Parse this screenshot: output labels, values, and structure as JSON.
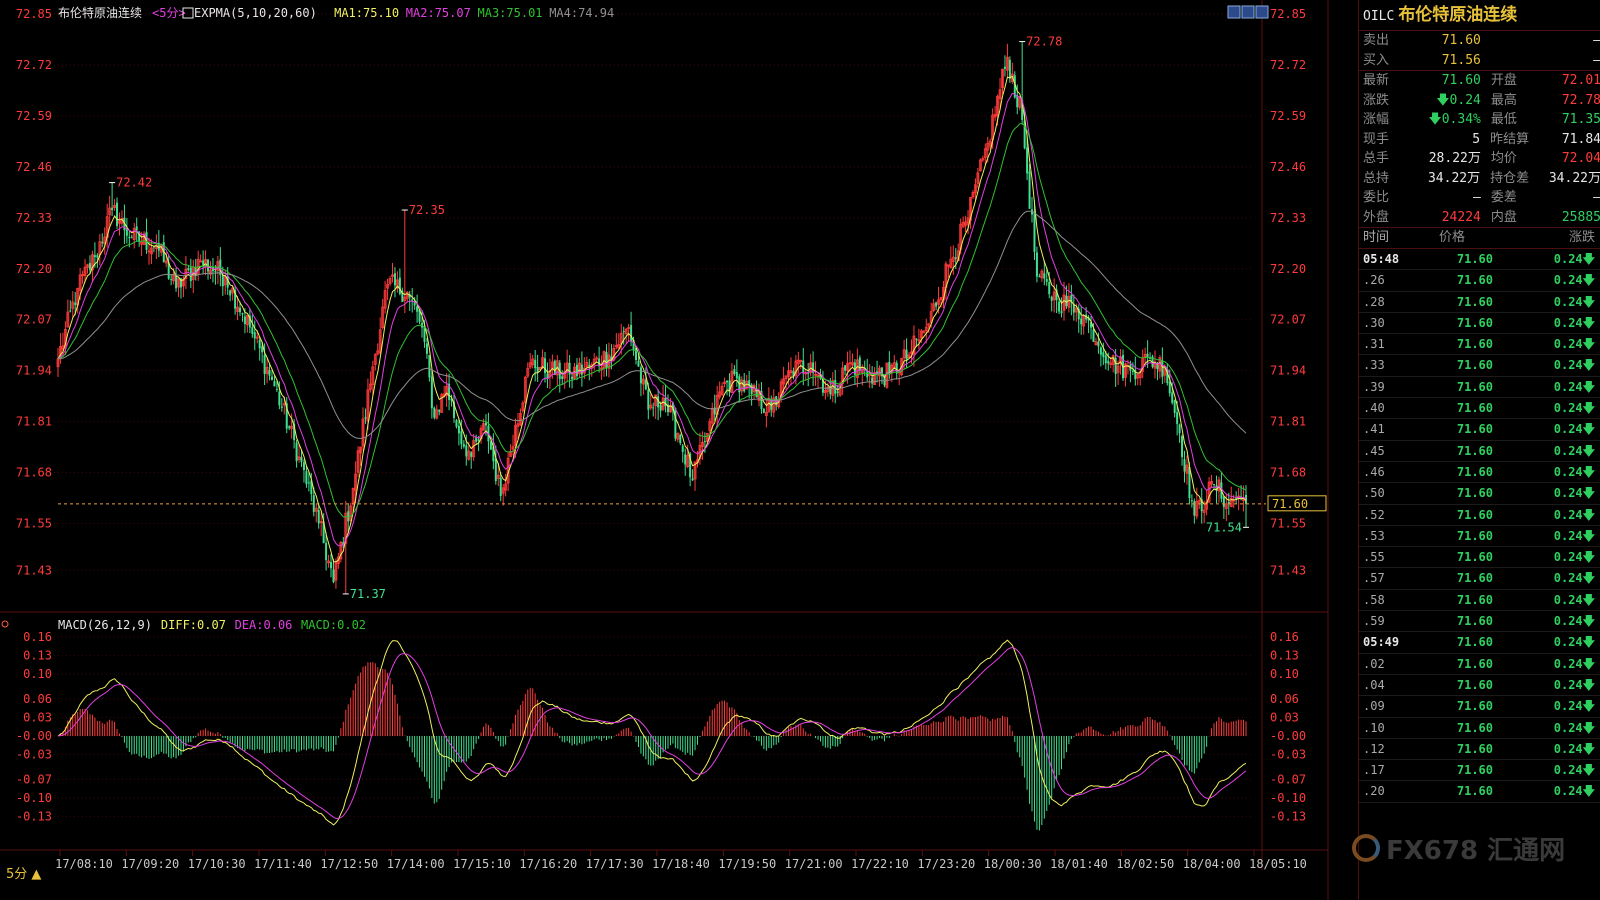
{
  "header": {
    "title": "布伦特原油连续",
    "period": "<5分>",
    "ema_label": "EXPMA(5,10,20,60)",
    "ma1": "MA1:75.10",
    "ma2": "MA2:75.07",
    "ma3": "MA3:75.01",
    "ma4": "MA4:74.94"
  },
  "macd_header": {
    "label": "MACD(26,12,9)",
    "diff": "DIFF:0.07",
    "dea": "DEA:0.06",
    "macd": "MACD:0.02"
  },
  "colors": {
    "up": "#ff3b3b",
    "down": "#40e090",
    "ma5": "#f0f060",
    "ma10": "#e040e0",
    "ma20": "#30c030",
    "ma60": "#909090",
    "axis": "#ff3b3b",
    "grid": "#3a0a0a"
  },
  "chart_data": [
    {
      "type": "candlestick",
      "title": "布伦特原油连续",
      "ylim": [
        71.38,
        72.83
      ],
      "y_ticks": [
        "72.85",
        "72.72",
        "72.59",
        "72.46",
        "72.33",
        "72.20",
        "72.07",
        "71.94",
        "71.81",
        "71.68",
        "71.55",
        "71.43"
      ],
      "x_ticks": [
        "17/08:10",
        "17/09:20",
        "17/10:30",
        "17/11:40",
        "17/12:50",
        "17/14:00",
        "17/15:10",
        "17/16:20",
        "17/17:30",
        "17/18:40",
        "17/19:50",
        "17/21:00",
        "17/22:10",
        "17/23:20",
        "18/00:30",
        "18/01:40",
        "18/02:50",
        "18/04:00",
        "18/05:10"
      ],
      "price_anchors": [
        [
          0,
          71.97
        ],
        [
          8,
          72.15
        ],
        [
          15,
          72.23
        ],
        [
          22,
          72.35
        ],
        [
          30,
          72.28
        ],
        [
          40,
          72.26
        ],
        [
          48,
          72.15
        ],
        [
          58,
          72.22
        ],
        [
          68,
          72.18
        ],
        [
          78,
          72.05
        ],
        [
          88,
          71.9
        ],
        [
          98,
          71.72
        ],
        [
          106,
          71.55
        ],
        [
          112,
          71.4
        ],
        [
          120,
          71.64
        ],
        [
          128,
          71.95
        ],
        [
          134,
          72.16
        ],
        [
          142,
          72.14
        ],
        [
          148,
          72.05
        ],
        [
          153,
          71.82
        ],
        [
          158,
          71.9
        ],
        [
          163,
          71.78
        ],
        [
          168,
          71.72
        ],
        [
          174,
          71.8
        ],
        [
          180,
          71.62
        ],
        [
          186,
          71.8
        ],
        [
          192,
          71.96
        ],
        [
          200,
          71.94
        ],
        [
          208,
          71.93
        ],
        [
          216,
          71.95
        ],
        [
          224,
          71.98
        ],
        [
          232,
          72.05
        ],
        [
          240,
          71.84
        ],
        [
          246,
          71.87
        ],
        [
          252,
          71.78
        ],
        [
          258,
          71.66
        ],
        [
          264,
          71.78
        ],
        [
          270,
          71.9
        ],
        [
          276,
          71.92
        ],
        [
          282,
          71.88
        ],
        [
          290,
          71.84
        ],
        [
          298,
          71.94
        ],
        [
          306,
          71.96
        ],
        [
          314,
          71.88
        ],
        [
          322,
          71.96
        ],
        [
          330,
          71.93
        ],
        [
          338,
          71.93
        ],
        [
          346,
          71.98
        ],
        [
          354,
          72.06
        ],
        [
          362,
          72.21
        ],
        [
          370,
          72.33
        ],
        [
          378,
          72.52
        ],
        [
          386,
          72.74
        ],
        [
          392,
          72.58
        ],
        [
          398,
          72.18
        ],
        [
          406,
          72.12
        ],
        [
          414,
          72.1
        ],
        [
          420,
          72.05
        ],
        [
          428,
          71.96
        ],
        [
          436,
          71.94
        ],
        [
          444,
          71.97
        ],
        [
          450,
          71.95
        ],
        [
          456,
          71.78
        ],
        [
          462,
          71.57
        ],
        [
          470,
          71.65
        ],
        [
          476,
          71.6
        ],
        [
          480,
          71.62
        ],
        [
          483,
          71.6
        ]
      ],
      "labels": [
        {
          "i": 22,
          "text": "72.42"
        },
        {
          "i": 117,
          "text": "71.37"
        },
        {
          "i": 141,
          "text": "72.35"
        },
        {
          "i": 392,
          "text": "72.78"
        },
        {
          "i": 483,
          "text": "71.54"
        }
      ],
      "last_price": "71.60",
      "series": [
        {
          "name": "MA1",
          "period": 5
        },
        {
          "name": "MA2",
          "period": 10
        },
        {
          "name": "MA3",
          "period": 20
        },
        {
          "name": "MA4",
          "period": 60
        }
      ]
    },
    {
      "type": "bar+line",
      "title": "MACD(26,12,9)",
      "ylim": [
        -0.165,
        0.165
      ],
      "y_ticks": [
        "0.16",
        "0.13",
        "0.10",
        "0.06",
        "0.03",
        "-0.00",
        "-0.03",
        "-0.07",
        "-0.10",
        "-0.13"
      ],
      "series": [
        {
          "name": "DIFF",
          "value": 0.07
        },
        {
          "name": "DEA",
          "value": 0.06
        },
        {
          "name": "MACD",
          "value": 0.02
        }
      ]
    }
  ],
  "panel": {
    "code": "OILC",
    "name": "布伦特原油连续",
    "quotes": [
      {
        "l": "卖出",
        "v": "71.60",
        "vc": "yellow",
        "l2": "",
        "v2": "—",
        "v2c": "white"
      },
      {
        "l": "买入",
        "v": "71.56",
        "vc": "yellow",
        "l2": "",
        "v2": "—",
        "v2c": "white"
      }
    ],
    "stats": [
      {
        "l": "最新",
        "v": "71.60",
        "vc": "green",
        "l2": "开盘",
        "v2": "72.01",
        "v2c": "red"
      },
      {
        "l": "涨跌",
        "v": "🡇0.24",
        "vc": "green",
        "l2": "最高",
        "v2": "72.78",
        "v2c": "red"
      },
      {
        "l": "涨幅",
        "v": "🡇0.34%",
        "vc": "green",
        "l2": "最低",
        "v2": "71.35",
        "v2c": "green"
      },
      {
        "l": "现手",
        "v": "5",
        "vc": "white",
        "l2": "昨结算",
        "v2": "71.84",
        "v2c": "white"
      },
      {
        "l": "总手",
        "v": "28.22万",
        "vc": "white",
        "l2": "均价",
        "v2": "72.04",
        "v2c": "red"
      },
      {
        "l": "总持",
        "v": "34.22万",
        "vc": "white",
        "l2": "持仓差",
        "v2": "34.22万",
        "v2c": "white"
      },
      {
        "l": "委比",
        "v": "—",
        "vc": "white",
        "l2": "委差",
        "v2": "—",
        "v2c": "white"
      },
      {
        "l": "外盘",
        "v": "24224",
        "vc": "red",
        "l2": "内盘",
        "v2": "25885",
        "v2c": "green"
      }
    ],
    "ticks_header": {
      "time": "时间",
      "price": "价格",
      "change": "涨跌"
    },
    "ticks": [
      {
        "t": "05:48",
        "p": "71.60",
        "c": "0.24🡇",
        "full": true
      },
      {
        "t": ".26",
        "p": "71.60",
        "c": "0.24🡇"
      },
      {
        "t": ".28",
        "p": "71.60",
        "c": "0.24🡇"
      },
      {
        "t": ".30",
        "p": "71.60",
        "c": "0.24🡇"
      },
      {
        "t": ".31",
        "p": "71.60",
        "c": "0.24🡇"
      },
      {
        "t": ".33",
        "p": "71.60",
        "c": "0.24🡇"
      },
      {
        "t": ".39",
        "p": "71.60",
        "c": "0.24🡇"
      },
      {
        "t": ".40",
        "p": "71.60",
        "c": "0.24🡇"
      },
      {
        "t": ".41",
        "p": "71.60",
        "c": "0.24🡇"
      },
      {
        "t": ".45",
        "p": "71.60",
        "c": "0.24🡇"
      },
      {
        "t": ".46",
        "p": "71.60",
        "c": "0.24🡇"
      },
      {
        "t": ".50",
        "p": "71.60",
        "c": "0.24🡇"
      },
      {
        "t": ".52",
        "p": "71.60",
        "c": "0.24🡇"
      },
      {
        "t": ".53",
        "p": "71.60",
        "c": "0.24🡇"
      },
      {
        "t": ".55",
        "p": "71.60",
        "c": "0.24🡇"
      },
      {
        "t": ".57",
        "p": "71.60",
        "c": "0.24🡇"
      },
      {
        "t": ".58",
        "p": "71.60",
        "c": "0.24🡇"
      },
      {
        "t": ".59",
        "p": "71.60",
        "c": "0.24🡇"
      },
      {
        "t": "05:49",
        "p": "71.60",
        "c": "0.24🡇",
        "full": true
      },
      {
        "t": ".02",
        "p": "71.60",
        "c": "0.24🡇"
      },
      {
        "t": ".04",
        "p": "71.60",
        "c": "0.24🡇"
      },
      {
        "t": ".09",
        "p": "71.60",
        "c": "0.24🡇"
      },
      {
        "t": ".10",
        "p": "71.60",
        "c": "0.24🡇"
      },
      {
        "t": ".12",
        "p": "71.60",
        "c": "0.24🡇"
      },
      {
        "t": ".17",
        "p": "71.60",
        "c": "0.24🡇"
      },
      {
        "t": ".20",
        "p": "71.60",
        "c": "0.24🡇"
      }
    ]
  },
  "period_button": "5分 ▲",
  "watermark": "FX678 汇通网"
}
